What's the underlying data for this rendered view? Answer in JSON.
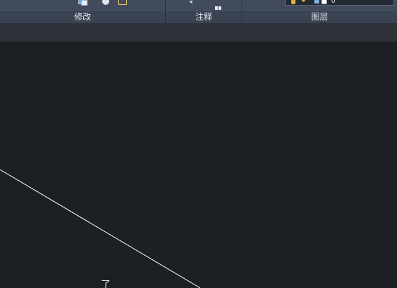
{
  "ribbon": {
    "panels": [
      {
        "label": "修改"
      },
      {
        "label": "注释"
      },
      {
        "label": "图层"
      }
    ],
    "layer_control": {
      "current_layer": "0",
      "color": "#ffffff"
    },
    "tool_icons": [
      "copy-icon",
      "circle-icon",
      "stretch-icon",
      "arrow-icon",
      "table-icon"
    ]
  },
  "colors": {
    "ribbon": "#3a4352",
    "canvas": "#1c1f24",
    "line": "#ffffff"
  },
  "canvas": {
    "cursor_glyph": "了"
  }
}
